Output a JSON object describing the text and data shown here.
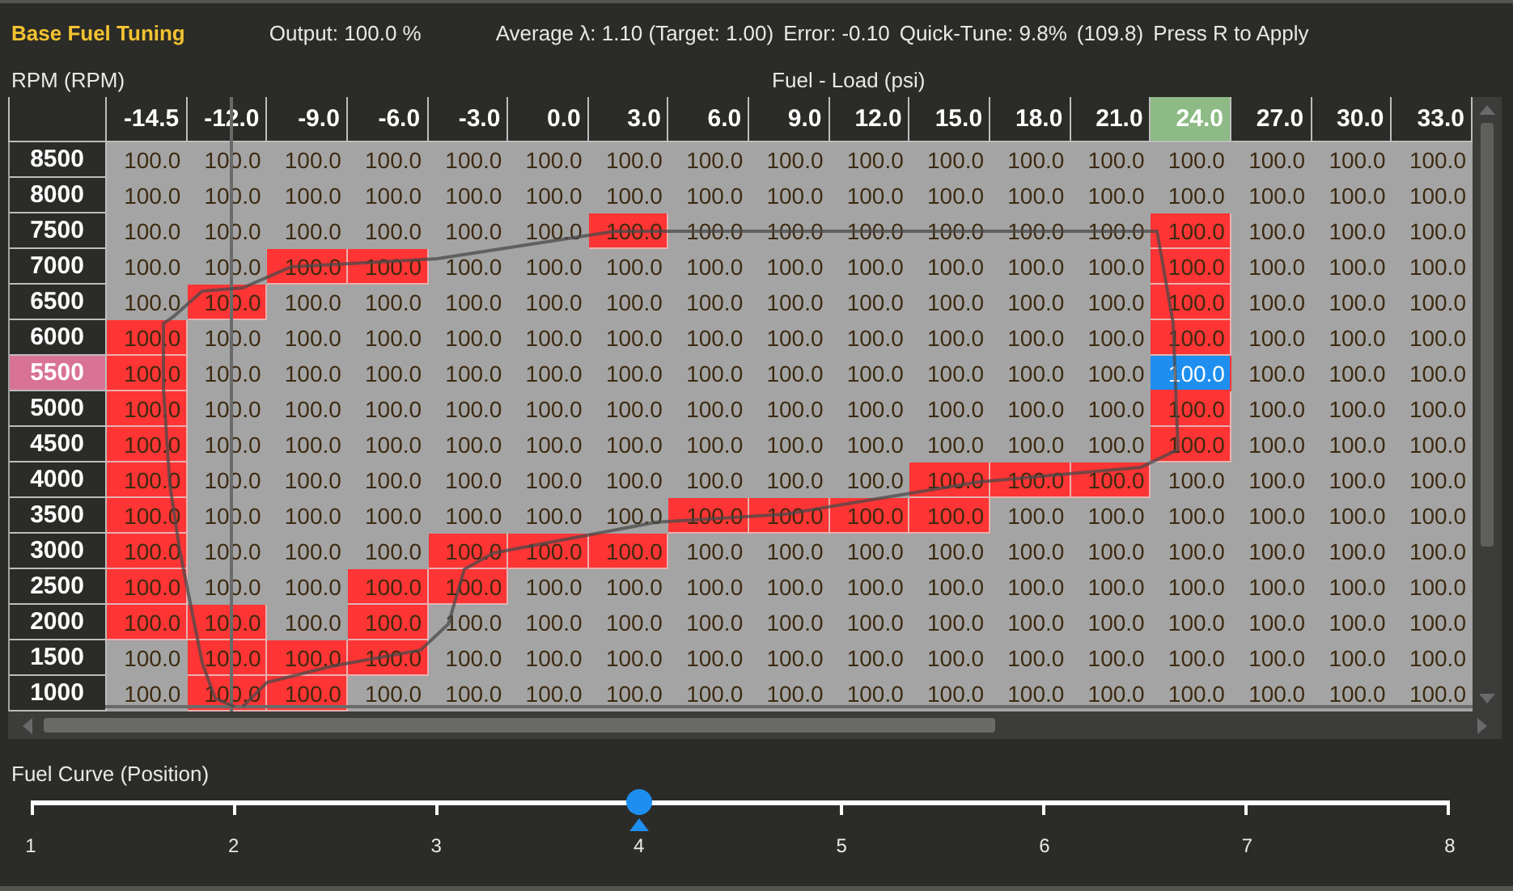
{
  "header": {
    "title": "Base Fuel Tuning",
    "output": "Output: 100.0 %",
    "average": "Average λ: 1.10 (Target: 1.00)",
    "error": "Error: -0.10",
    "quick_tune": "Quick-Tune: 9.8%",
    "quick_tune_value": "(109.8)",
    "hint": "Press R to Apply"
  },
  "table": {
    "row_axis_label": "RPM (RPM)",
    "column_axis_label": "Fuel - Load (psi)",
    "columns": [
      {
        "label": "-14.5",
        "selected": false
      },
      {
        "label": "-12.0",
        "selected": false
      },
      {
        "label": "-9.0",
        "selected": false
      },
      {
        "label": "-6.0",
        "selected": false
      },
      {
        "label": "-3.0",
        "selected": false
      },
      {
        "label": "0.0",
        "selected": false
      },
      {
        "label": "3.0",
        "selected": false
      },
      {
        "label": "6.0",
        "selected": false
      },
      {
        "label": "9.0",
        "selected": false
      },
      {
        "label": "12.0",
        "selected": false
      },
      {
        "label": "15.0",
        "selected": false
      },
      {
        "label": "18.0",
        "selected": false
      },
      {
        "label": "21.0",
        "selected": false
      },
      {
        "label": "24.0",
        "selected": true
      },
      {
        "label": "27.0",
        "selected": false
      },
      {
        "label": "30.0",
        "selected": false
      },
      {
        "label": "33.0",
        "selected": false
      }
    ],
    "rows": [
      {
        "label": "8500",
        "selected": false,
        "cells": [
          {
            "value": "100.0",
            "highlighted": false,
            "selected": false
          },
          {
            "value": "100.0",
            "highlighted": false,
            "selected": false
          },
          {
            "value": "100.0",
            "highlighted": false,
            "selected": false
          },
          {
            "value": "100.0",
            "highlighted": false,
            "selected": false
          },
          {
            "value": "100.0",
            "highlighted": false,
            "selected": false
          },
          {
            "value": "100.0",
            "highlighted": false,
            "selected": false
          },
          {
            "value": "100.0",
            "highlighted": false,
            "selected": false
          },
          {
            "value": "100.0",
            "highlighted": false,
            "selected": false
          },
          {
            "value": "100.0",
            "highlighted": false,
            "selected": false
          },
          {
            "value": "100.0",
            "highlighted": false,
            "selected": false
          },
          {
            "value": "100.0",
            "highlighted": false,
            "selected": false
          },
          {
            "value": "100.0",
            "highlighted": false,
            "selected": false
          },
          {
            "value": "100.0",
            "highlighted": false,
            "selected": false
          },
          {
            "value": "100.0",
            "highlighted": false,
            "selected": false
          },
          {
            "value": "100.0",
            "highlighted": false,
            "selected": false
          },
          {
            "value": "100.0",
            "highlighted": false,
            "selected": false
          },
          {
            "value": "100.0",
            "highlighted": false,
            "selected": false
          }
        ]
      },
      {
        "label": "8000",
        "selected": false,
        "cells": [
          {
            "value": "100.0",
            "highlighted": false,
            "selected": false
          },
          {
            "value": "100.0",
            "highlighted": false,
            "selected": false
          },
          {
            "value": "100.0",
            "highlighted": false,
            "selected": false
          },
          {
            "value": "100.0",
            "highlighted": false,
            "selected": false
          },
          {
            "value": "100.0",
            "highlighted": false,
            "selected": false
          },
          {
            "value": "100.0",
            "highlighted": false,
            "selected": false
          },
          {
            "value": "100.0",
            "highlighted": false,
            "selected": false
          },
          {
            "value": "100.0",
            "highlighted": false,
            "selected": false
          },
          {
            "value": "100.0",
            "highlighted": false,
            "selected": false
          },
          {
            "value": "100.0",
            "highlighted": false,
            "selected": false
          },
          {
            "value": "100.0",
            "highlighted": false,
            "selected": false
          },
          {
            "value": "100.0",
            "highlighted": false,
            "selected": false
          },
          {
            "value": "100.0",
            "highlighted": false,
            "selected": false
          },
          {
            "value": "100.0",
            "highlighted": false,
            "selected": false
          },
          {
            "value": "100.0",
            "highlighted": false,
            "selected": false
          },
          {
            "value": "100.0",
            "highlighted": false,
            "selected": false
          },
          {
            "value": "100.0",
            "highlighted": false,
            "selected": false
          }
        ]
      },
      {
        "label": "7500",
        "selected": false,
        "cells": [
          {
            "value": "100.0",
            "highlighted": false,
            "selected": false
          },
          {
            "value": "100.0",
            "highlighted": false,
            "selected": false
          },
          {
            "value": "100.0",
            "highlighted": false,
            "selected": false
          },
          {
            "value": "100.0",
            "highlighted": false,
            "selected": false
          },
          {
            "value": "100.0",
            "highlighted": false,
            "selected": false
          },
          {
            "value": "100.0",
            "highlighted": false,
            "selected": false
          },
          {
            "value": "100.0",
            "highlighted": true,
            "selected": false
          },
          {
            "value": "100.0",
            "highlighted": false,
            "selected": false
          },
          {
            "value": "100.0",
            "highlighted": false,
            "selected": false
          },
          {
            "value": "100.0",
            "highlighted": false,
            "selected": false
          },
          {
            "value": "100.0",
            "highlighted": false,
            "selected": false
          },
          {
            "value": "100.0",
            "highlighted": false,
            "selected": false
          },
          {
            "value": "100.0",
            "highlighted": false,
            "selected": false
          },
          {
            "value": "100.0",
            "highlighted": true,
            "selected": false
          },
          {
            "value": "100.0",
            "highlighted": false,
            "selected": false
          },
          {
            "value": "100.0",
            "highlighted": false,
            "selected": false
          },
          {
            "value": "100.0",
            "highlighted": false,
            "selected": false
          }
        ]
      },
      {
        "label": "7000",
        "selected": false,
        "cells": [
          {
            "value": "100.0",
            "highlighted": false,
            "selected": false
          },
          {
            "value": "100.0",
            "highlighted": false,
            "selected": false
          },
          {
            "value": "100.0",
            "highlighted": true,
            "selected": false
          },
          {
            "value": "100.0",
            "highlighted": true,
            "selected": false
          },
          {
            "value": "100.0",
            "highlighted": false,
            "selected": false
          },
          {
            "value": "100.0",
            "highlighted": false,
            "selected": false
          },
          {
            "value": "100.0",
            "highlighted": false,
            "selected": false
          },
          {
            "value": "100.0",
            "highlighted": false,
            "selected": false
          },
          {
            "value": "100.0",
            "highlighted": false,
            "selected": false
          },
          {
            "value": "100.0",
            "highlighted": false,
            "selected": false
          },
          {
            "value": "100.0",
            "highlighted": false,
            "selected": false
          },
          {
            "value": "100.0",
            "highlighted": false,
            "selected": false
          },
          {
            "value": "100.0",
            "highlighted": false,
            "selected": false
          },
          {
            "value": "100.0",
            "highlighted": true,
            "selected": false
          },
          {
            "value": "100.0",
            "highlighted": false,
            "selected": false
          },
          {
            "value": "100.0",
            "highlighted": false,
            "selected": false
          },
          {
            "value": "100.0",
            "highlighted": false,
            "selected": false
          }
        ]
      },
      {
        "label": "6500",
        "selected": false,
        "cells": [
          {
            "value": "100.0",
            "highlighted": false,
            "selected": false
          },
          {
            "value": "100.0",
            "highlighted": true,
            "selected": false
          },
          {
            "value": "100.0",
            "highlighted": false,
            "selected": false
          },
          {
            "value": "100.0",
            "highlighted": false,
            "selected": false
          },
          {
            "value": "100.0",
            "highlighted": false,
            "selected": false
          },
          {
            "value": "100.0",
            "highlighted": false,
            "selected": false
          },
          {
            "value": "100.0",
            "highlighted": false,
            "selected": false
          },
          {
            "value": "100.0",
            "highlighted": false,
            "selected": false
          },
          {
            "value": "100.0",
            "highlighted": false,
            "selected": false
          },
          {
            "value": "100.0",
            "highlighted": false,
            "selected": false
          },
          {
            "value": "100.0",
            "highlighted": false,
            "selected": false
          },
          {
            "value": "100.0",
            "highlighted": false,
            "selected": false
          },
          {
            "value": "100.0",
            "highlighted": false,
            "selected": false
          },
          {
            "value": "100.0",
            "highlighted": true,
            "selected": false
          },
          {
            "value": "100.0",
            "highlighted": false,
            "selected": false
          },
          {
            "value": "100.0",
            "highlighted": false,
            "selected": false
          },
          {
            "value": "100.0",
            "highlighted": false,
            "selected": false
          }
        ]
      },
      {
        "label": "6000",
        "selected": false,
        "cells": [
          {
            "value": "100.0",
            "highlighted": true,
            "selected": false
          },
          {
            "value": "100.0",
            "highlighted": false,
            "selected": false
          },
          {
            "value": "100.0",
            "highlighted": false,
            "selected": false
          },
          {
            "value": "100.0",
            "highlighted": false,
            "selected": false
          },
          {
            "value": "100.0",
            "highlighted": false,
            "selected": false
          },
          {
            "value": "100.0",
            "highlighted": false,
            "selected": false
          },
          {
            "value": "100.0",
            "highlighted": false,
            "selected": false
          },
          {
            "value": "100.0",
            "highlighted": false,
            "selected": false
          },
          {
            "value": "100.0",
            "highlighted": false,
            "selected": false
          },
          {
            "value": "100.0",
            "highlighted": false,
            "selected": false
          },
          {
            "value": "100.0",
            "highlighted": false,
            "selected": false
          },
          {
            "value": "100.0",
            "highlighted": false,
            "selected": false
          },
          {
            "value": "100.0",
            "highlighted": false,
            "selected": false
          },
          {
            "value": "100.0",
            "highlighted": true,
            "selected": false
          },
          {
            "value": "100.0",
            "highlighted": false,
            "selected": false
          },
          {
            "value": "100.0",
            "highlighted": false,
            "selected": false
          },
          {
            "value": "100.0",
            "highlighted": false,
            "selected": false
          }
        ]
      },
      {
        "label": "5500",
        "selected": true,
        "cells": [
          {
            "value": "100.0",
            "highlighted": true,
            "selected": false
          },
          {
            "value": "100.0",
            "highlighted": false,
            "selected": false
          },
          {
            "value": "100.0",
            "highlighted": false,
            "selected": false
          },
          {
            "value": "100.0",
            "highlighted": false,
            "selected": false
          },
          {
            "value": "100.0",
            "highlighted": false,
            "selected": false
          },
          {
            "value": "100.0",
            "highlighted": false,
            "selected": false
          },
          {
            "value": "100.0",
            "highlighted": false,
            "selected": false
          },
          {
            "value": "100.0",
            "highlighted": false,
            "selected": false
          },
          {
            "value": "100.0",
            "highlighted": false,
            "selected": false
          },
          {
            "value": "100.0",
            "highlighted": false,
            "selected": false
          },
          {
            "value": "100.0",
            "highlighted": false,
            "selected": false
          },
          {
            "value": "100.0",
            "highlighted": false,
            "selected": false
          },
          {
            "value": "100.0",
            "highlighted": false,
            "selected": false
          },
          {
            "value": "100.0",
            "highlighted": true,
            "selected": true
          },
          {
            "value": "100.0",
            "highlighted": false,
            "selected": false
          },
          {
            "value": "100.0",
            "highlighted": false,
            "selected": false
          },
          {
            "value": "100.0",
            "highlighted": false,
            "selected": false
          }
        ]
      },
      {
        "label": "5000",
        "selected": false,
        "cells": [
          {
            "value": "100.0",
            "highlighted": true,
            "selected": false
          },
          {
            "value": "100.0",
            "highlighted": false,
            "selected": false
          },
          {
            "value": "100.0",
            "highlighted": false,
            "selected": false
          },
          {
            "value": "100.0",
            "highlighted": false,
            "selected": false
          },
          {
            "value": "100.0",
            "highlighted": false,
            "selected": false
          },
          {
            "value": "100.0",
            "highlighted": false,
            "selected": false
          },
          {
            "value": "100.0",
            "highlighted": false,
            "selected": false
          },
          {
            "value": "100.0",
            "highlighted": false,
            "selected": false
          },
          {
            "value": "100.0",
            "highlighted": false,
            "selected": false
          },
          {
            "value": "100.0",
            "highlighted": false,
            "selected": false
          },
          {
            "value": "100.0",
            "highlighted": false,
            "selected": false
          },
          {
            "value": "100.0",
            "highlighted": false,
            "selected": false
          },
          {
            "value": "100.0",
            "highlighted": false,
            "selected": false
          },
          {
            "value": "100.0",
            "highlighted": true,
            "selected": false
          },
          {
            "value": "100.0",
            "highlighted": false,
            "selected": false
          },
          {
            "value": "100.0",
            "highlighted": false,
            "selected": false
          },
          {
            "value": "100.0",
            "highlighted": false,
            "selected": false
          }
        ]
      },
      {
        "label": "4500",
        "selected": false,
        "cells": [
          {
            "value": "100.0",
            "highlighted": true,
            "selected": false
          },
          {
            "value": "100.0",
            "highlighted": false,
            "selected": false
          },
          {
            "value": "100.0",
            "highlighted": false,
            "selected": false
          },
          {
            "value": "100.0",
            "highlighted": false,
            "selected": false
          },
          {
            "value": "100.0",
            "highlighted": false,
            "selected": false
          },
          {
            "value": "100.0",
            "highlighted": false,
            "selected": false
          },
          {
            "value": "100.0",
            "highlighted": false,
            "selected": false
          },
          {
            "value": "100.0",
            "highlighted": false,
            "selected": false
          },
          {
            "value": "100.0",
            "highlighted": false,
            "selected": false
          },
          {
            "value": "100.0",
            "highlighted": false,
            "selected": false
          },
          {
            "value": "100.0",
            "highlighted": false,
            "selected": false
          },
          {
            "value": "100.0",
            "highlighted": false,
            "selected": false
          },
          {
            "value": "100.0",
            "highlighted": false,
            "selected": false
          },
          {
            "value": "100.0",
            "highlighted": true,
            "selected": false
          },
          {
            "value": "100.0",
            "highlighted": false,
            "selected": false
          },
          {
            "value": "100.0",
            "highlighted": false,
            "selected": false
          },
          {
            "value": "100.0",
            "highlighted": false,
            "selected": false
          }
        ]
      },
      {
        "label": "4000",
        "selected": false,
        "cells": [
          {
            "value": "100.0",
            "highlighted": true,
            "selected": false
          },
          {
            "value": "100.0",
            "highlighted": false,
            "selected": false
          },
          {
            "value": "100.0",
            "highlighted": false,
            "selected": false
          },
          {
            "value": "100.0",
            "highlighted": false,
            "selected": false
          },
          {
            "value": "100.0",
            "highlighted": false,
            "selected": false
          },
          {
            "value": "100.0",
            "highlighted": false,
            "selected": false
          },
          {
            "value": "100.0",
            "highlighted": false,
            "selected": false
          },
          {
            "value": "100.0",
            "highlighted": false,
            "selected": false
          },
          {
            "value": "100.0",
            "highlighted": false,
            "selected": false
          },
          {
            "value": "100.0",
            "highlighted": false,
            "selected": false
          },
          {
            "value": "100.0",
            "highlighted": true,
            "selected": false
          },
          {
            "value": "100.0",
            "highlighted": true,
            "selected": false
          },
          {
            "value": "100.0",
            "highlighted": true,
            "selected": false
          },
          {
            "value": "100.0",
            "highlighted": false,
            "selected": false
          },
          {
            "value": "100.0",
            "highlighted": false,
            "selected": false
          },
          {
            "value": "100.0",
            "highlighted": false,
            "selected": false
          },
          {
            "value": "100.0",
            "highlighted": false,
            "selected": false
          }
        ]
      },
      {
        "label": "3500",
        "selected": false,
        "cells": [
          {
            "value": "100.0",
            "highlighted": true,
            "selected": false
          },
          {
            "value": "100.0",
            "highlighted": false,
            "selected": false
          },
          {
            "value": "100.0",
            "highlighted": false,
            "selected": false
          },
          {
            "value": "100.0",
            "highlighted": false,
            "selected": false
          },
          {
            "value": "100.0",
            "highlighted": false,
            "selected": false
          },
          {
            "value": "100.0",
            "highlighted": false,
            "selected": false
          },
          {
            "value": "100.0",
            "highlighted": false,
            "selected": false
          },
          {
            "value": "100.0",
            "highlighted": true,
            "selected": false
          },
          {
            "value": "100.0",
            "highlighted": true,
            "selected": false
          },
          {
            "value": "100.0",
            "highlighted": true,
            "selected": false
          },
          {
            "value": "100.0",
            "highlighted": true,
            "selected": false
          },
          {
            "value": "100.0",
            "highlighted": false,
            "selected": false
          },
          {
            "value": "100.0",
            "highlighted": false,
            "selected": false
          },
          {
            "value": "100.0",
            "highlighted": false,
            "selected": false
          },
          {
            "value": "100.0",
            "highlighted": false,
            "selected": false
          },
          {
            "value": "100.0",
            "highlighted": false,
            "selected": false
          },
          {
            "value": "100.0",
            "highlighted": false,
            "selected": false
          }
        ]
      },
      {
        "label": "3000",
        "selected": false,
        "cells": [
          {
            "value": "100.0",
            "highlighted": true,
            "selected": false
          },
          {
            "value": "100.0",
            "highlighted": false,
            "selected": false
          },
          {
            "value": "100.0",
            "highlighted": false,
            "selected": false
          },
          {
            "value": "100.0",
            "highlighted": false,
            "selected": false
          },
          {
            "value": "100.0",
            "highlighted": true,
            "selected": false
          },
          {
            "value": "100.0",
            "highlighted": true,
            "selected": false
          },
          {
            "value": "100.0",
            "highlighted": true,
            "selected": false
          },
          {
            "value": "100.0",
            "highlighted": false,
            "selected": false
          },
          {
            "value": "100.0",
            "highlighted": false,
            "selected": false
          },
          {
            "value": "100.0",
            "highlighted": false,
            "selected": false
          },
          {
            "value": "100.0",
            "highlighted": false,
            "selected": false
          },
          {
            "value": "100.0",
            "highlighted": false,
            "selected": false
          },
          {
            "value": "100.0",
            "highlighted": false,
            "selected": false
          },
          {
            "value": "100.0",
            "highlighted": false,
            "selected": false
          },
          {
            "value": "100.0",
            "highlighted": false,
            "selected": false
          },
          {
            "value": "100.0",
            "highlighted": false,
            "selected": false
          },
          {
            "value": "100.0",
            "highlighted": false,
            "selected": false
          }
        ]
      },
      {
        "label": "2500",
        "selected": false,
        "cells": [
          {
            "value": "100.0",
            "highlighted": true,
            "selected": false
          },
          {
            "value": "100.0",
            "highlighted": false,
            "selected": false
          },
          {
            "value": "100.0",
            "highlighted": false,
            "selected": false
          },
          {
            "value": "100.0",
            "highlighted": true,
            "selected": false
          },
          {
            "value": "100.0",
            "highlighted": true,
            "selected": false
          },
          {
            "value": "100.0",
            "highlighted": false,
            "selected": false
          },
          {
            "value": "100.0",
            "highlighted": false,
            "selected": false
          },
          {
            "value": "100.0",
            "highlighted": false,
            "selected": false
          },
          {
            "value": "100.0",
            "highlighted": false,
            "selected": false
          },
          {
            "value": "100.0",
            "highlighted": false,
            "selected": false
          },
          {
            "value": "100.0",
            "highlighted": false,
            "selected": false
          },
          {
            "value": "100.0",
            "highlighted": false,
            "selected": false
          },
          {
            "value": "100.0",
            "highlighted": false,
            "selected": false
          },
          {
            "value": "100.0",
            "highlighted": false,
            "selected": false
          },
          {
            "value": "100.0",
            "highlighted": false,
            "selected": false
          },
          {
            "value": "100.0",
            "highlighted": false,
            "selected": false
          },
          {
            "value": "100.0",
            "highlighted": false,
            "selected": false
          }
        ]
      },
      {
        "label": "2000",
        "selected": false,
        "cells": [
          {
            "value": "100.0",
            "highlighted": true,
            "selected": false
          },
          {
            "value": "100.0",
            "highlighted": true,
            "selected": false
          },
          {
            "value": "100.0",
            "highlighted": false,
            "selected": false
          },
          {
            "value": "100.0",
            "highlighted": true,
            "selected": false
          },
          {
            "value": "100.0",
            "highlighted": false,
            "selected": false
          },
          {
            "value": "100.0",
            "highlighted": false,
            "selected": false
          },
          {
            "value": "100.0",
            "highlighted": false,
            "selected": false
          },
          {
            "value": "100.0",
            "highlighted": false,
            "selected": false
          },
          {
            "value": "100.0",
            "highlighted": false,
            "selected": false
          },
          {
            "value": "100.0",
            "highlighted": false,
            "selected": false
          },
          {
            "value": "100.0",
            "highlighted": false,
            "selected": false
          },
          {
            "value": "100.0",
            "highlighted": false,
            "selected": false
          },
          {
            "value": "100.0",
            "highlighted": false,
            "selected": false
          },
          {
            "value": "100.0",
            "highlighted": false,
            "selected": false
          },
          {
            "value": "100.0",
            "highlighted": false,
            "selected": false
          },
          {
            "value": "100.0",
            "highlighted": false,
            "selected": false
          },
          {
            "value": "100.0",
            "highlighted": false,
            "selected": false
          }
        ]
      },
      {
        "label": "1500",
        "selected": false,
        "cells": [
          {
            "value": "100.0",
            "highlighted": false,
            "selected": false
          },
          {
            "value": "100.0",
            "highlighted": true,
            "selected": false
          },
          {
            "value": "100.0",
            "highlighted": true,
            "selected": false
          },
          {
            "value": "100.0",
            "highlighted": true,
            "selected": false
          },
          {
            "value": "100.0",
            "highlighted": false,
            "selected": false
          },
          {
            "value": "100.0",
            "highlighted": false,
            "selected": false
          },
          {
            "value": "100.0",
            "highlighted": false,
            "selected": false
          },
          {
            "value": "100.0",
            "highlighted": false,
            "selected": false
          },
          {
            "value": "100.0",
            "highlighted": false,
            "selected": false
          },
          {
            "value": "100.0",
            "highlighted": false,
            "selected": false
          },
          {
            "value": "100.0",
            "highlighted": false,
            "selected": false
          },
          {
            "value": "100.0",
            "highlighted": false,
            "selected": false
          },
          {
            "value": "100.0",
            "highlighted": false,
            "selected": false
          },
          {
            "value": "100.0",
            "highlighted": false,
            "selected": false
          },
          {
            "value": "100.0",
            "highlighted": false,
            "selected": false
          },
          {
            "value": "100.0",
            "highlighted": false,
            "selected": false
          },
          {
            "value": "100.0",
            "highlighted": false,
            "selected": false
          }
        ]
      },
      {
        "label": "1000",
        "selected": false,
        "cells": [
          {
            "value": "100.0",
            "highlighted": false,
            "selected": false
          },
          {
            "value": "100.0",
            "highlighted": true,
            "selected": false
          },
          {
            "value": "100.0",
            "highlighted": true,
            "selected": false
          },
          {
            "value": "100.0",
            "highlighted": false,
            "selected": false
          },
          {
            "value": "100.0",
            "highlighted": false,
            "selected": false
          },
          {
            "value": "100.0",
            "highlighted": false,
            "selected": false
          },
          {
            "value": "100.0",
            "highlighted": false,
            "selected": false
          },
          {
            "value": "100.0",
            "highlighted": false,
            "selected": false
          },
          {
            "value": "100.0",
            "highlighted": false,
            "selected": false
          },
          {
            "value": "100.0",
            "highlighted": false,
            "selected": false
          },
          {
            "value": "100.0",
            "highlighted": false,
            "selected": false
          },
          {
            "value": "100.0",
            "highlighted": false,
            "selected": false
          },
          {
            "value": "100.0",
            "highlighted": false,
            "selected": false
          },
          {
            "value": "100.0",
            "highlighted": false,
            "selected": false
          },
          {
            "value": "100.0",
            "highlighted": false,
            "selected": false
          },
          {
            "value": "100.0",
            "highlighted": false,
            "selected": false
          },
          {
            "value": "100.0",
            "highlighted": false,
            "selected": false
          }
        ]
      }
    ]
  },
  "slider": {
    "label": "Fuel Curve  (Position)",
    "level": 0.4286,
    "ticks": [
      "1",
      "2",
      "3",
      "4",
      "5",
      "6",
      "7",
      "8"
    ]
  }
}
